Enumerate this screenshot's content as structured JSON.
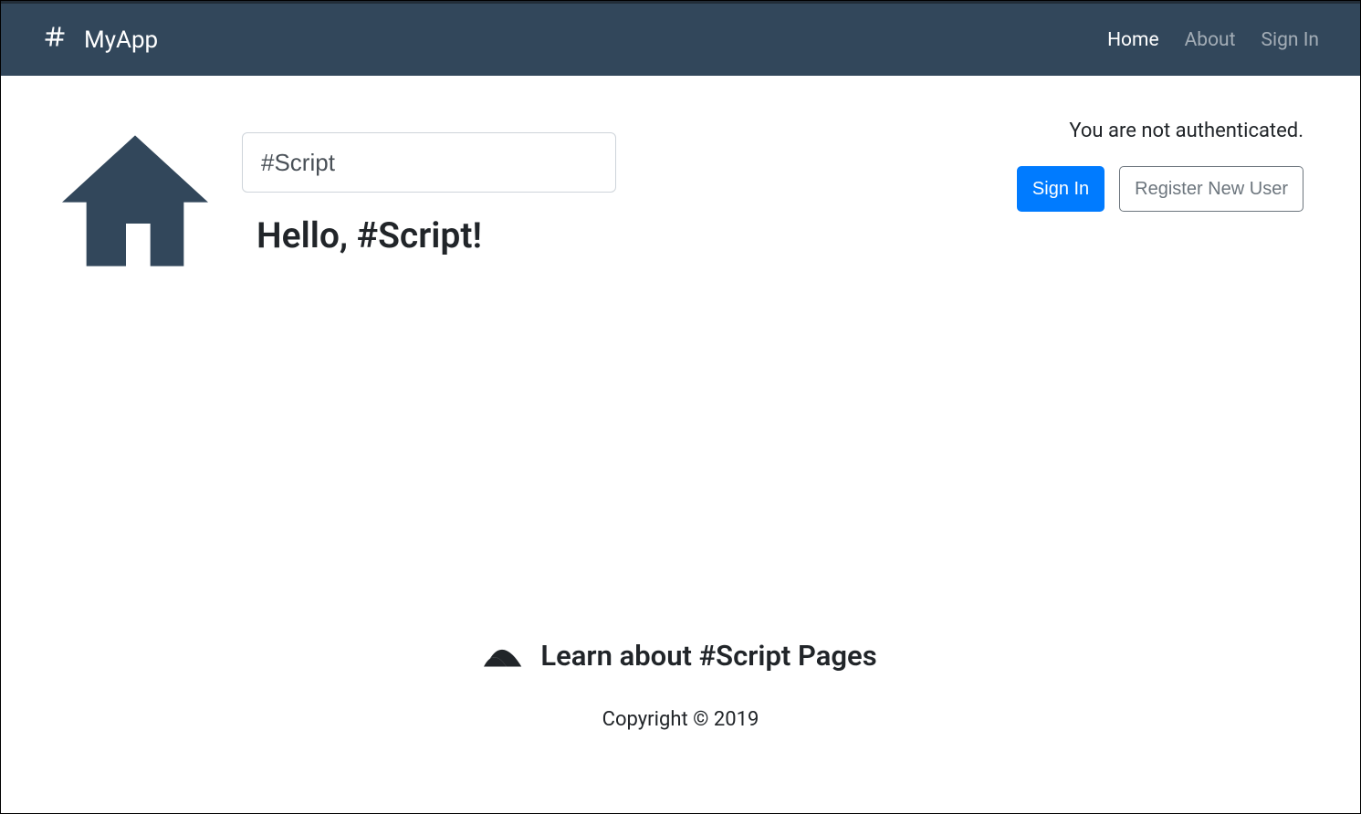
{
  "navbar": {
    "brand": "MyApp",
    "links": {
      "home": "Home",
      "about": "About",
      "signin": "Sign In"
    }
  },
  "main": {
    "name_input_value": "#Script",
    "name_input_placeholder": "",
    "greeting": "Hello, #Script!"
  },
  "auth": {
    "status": "You are not authenticated.",
    "signin_label": "Sign In",
    "register_label": "Register New User"
  },
  "footer": {
    "learn_text": "Learn about #Script Pages",
    "copyright": "Copyright © 2019"
  }
}
